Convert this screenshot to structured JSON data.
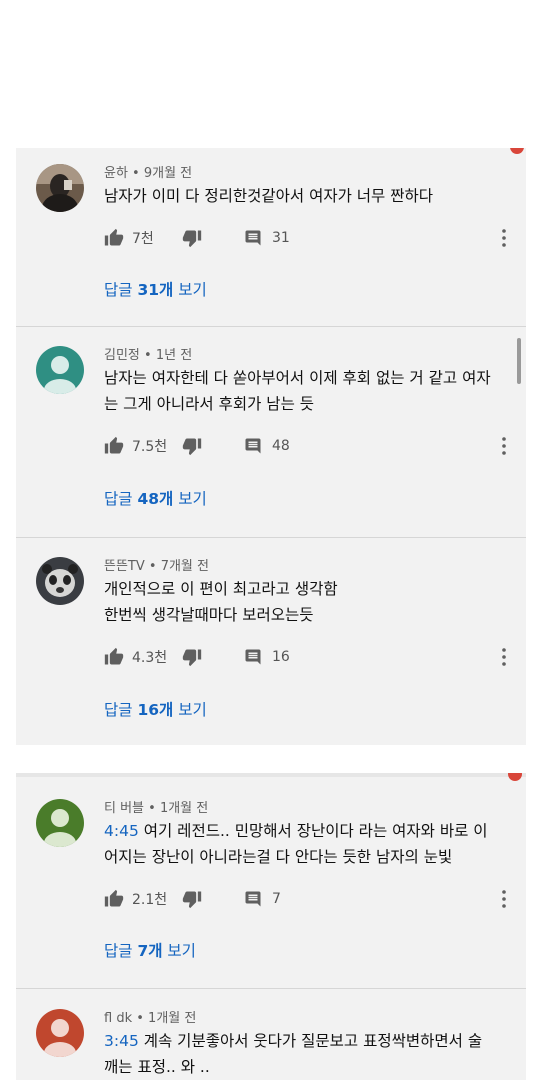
{
  "comments": [
    {
      "author": "윤하",
      "time": "9개월 전",
      "lines": [
        "남자가 이미 다 정리한것같아서 여자가 너무 짠하다"
      ],
      "likes": "7천",
      "replies": "31",
      "view_replies_prefix": "답글 ",
      "view_replies_count": "31개",
      "view_replies_suffix": " 보기"
    },
    {
      "author": "김민정",
      "time": "1년 전",
      "lines": [
        "남자는 여자한테 다 쏟아부어서 이제 후회 없는 거 같고 여자",
        "는 그게 아니라서 후회가 남는 듯"
      ],
      "likes": "7.5천",
      "replies": "48",
      "view_replies_prefix": "답글 ",
      "view_replies_count": "48개",
      "view_replies_suffix": " 보기"
    },
    {
      "author": "뜬뜬TV",
      "time": "7개월 전",
      "lines": [
        "개인적으로 이 편이 최고라고 생각함",
        "한번씩 생각날때마다 보러오는듯"
      ],
      "likes": "4.3천",
      "replies": "16",
      "view_replies_prefix": "답글 ",
      "view_replies_count": "16개",
      "view_replies_suffix": " 보기"
    },
    {
      "author": "티 버블",
      "time": "1개월 전",
      "timestamp_link": "4:45",
      "lines": [
        " 여기 레전드.. 민망해서 장난이다 라는 여자와  바로 이",
        "어지는 장난이 아니라는걸 다 안다는 듯한 남자의 눈빛"
      ],
      "likes": "2.1천",
      "replies": "7",
      "view_replies_prefix": "답글 ",
      "view_replies_count": "7개",
      "view_replies_suffix": " 보기"
    },
    {
      "author": "fl dk",
      "time": "1개월 전",
      "timestamp_link": "3:45",
      "lines": [
        " 계속 기분좋아서 웃다가 질문보고 표정싹변하면서 술",
        "깨는 표정.. 와 .."
      ]
    }
  ],
  "separator": " • ",
  "icons": {
    "like": "thumb-up-icon",
    "dislike": "thumb-down-icon",
    "reply": "comment-icon",
    "more": "more-vert-icon"
  },
  "colors": {
    "panel": "#f2f2f2",
    "link": "#1565c0",
    "meta": "#606060",
    "accent_red": "#d9463a"
  }
}
